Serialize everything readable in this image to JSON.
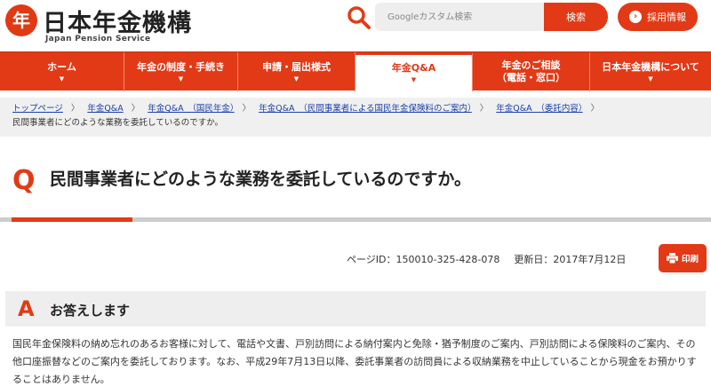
{
  "header": {
    "logo_mark": "年",
    "logo_title": "日本年金機構",
    "logo_subtitle": "Japan Pension Service",
    "search_placeholder": "Googleカスタム検索",
    "search_button": "検索",
    "recruit_button": "採用情報"
  },
  "nav": {
    "items": [
      {
        "label": "ホーム"
      },
      {
        "label": "年金の制度・手続き"
      },
      {
        "label": "申請・届出様式"
      },
      {
        "label": "年金Q&A"
      },
      {
        "label_line1": "年金のご相談",
        "label_line2": "（電話・窓口）"
      },
      {
        "label": "日本年金機構について"
      }
    ]
  },
  "breadcrumb": {
    "items": [
      "トップページ",
      "年金Q&A",
      "年金Q&A　（国民年金）",
      "年金Q&A　（民間事業者による国民年金保険料のご案内）",
      "年金Q&A　（委託内容）"
    ],
    "current": "民間事業者にどのような業務を委託しているのですか。"
  },
  "question": {
    "mark": "Q",
    "title": "民間事業者にどのような業務を委託しているのですか。"
  },
  "meta": {
    "page_id": "ページID：150010-325-428-078",
    "updated": "更新日：2017年7月12日",
    "print_label": "印刷"
  },
  "answer": {
    "mark": "A",
    "heading": "お答えします",
    "body": "国民年金保険料の納め忘れのあるお客様に対して、電話や文書、戸別訪問による納付案内と免除・猶予制度のご案内、戸別訪問による保険料のご案内、その他口座振替などのご案内を委託しております。なお、平成29年7月13日以降、委託事業者の訪問員による収納業務を中止していることから現金をお預かりすることはありません。"
  },
  "colors": {
    "accent": "#e23a16",
    "link": "#1a3fa8",
    "breadcrumb_bg": "#f0f0f0",
    "answer_bg": "#eeeeee"
  },
  "icons": {
    "search": "search-icon",
    "print": "printer-icon",
    "chevron": "chevron-right-icon",
    "caret": "caret-down-icon"
  }
}
